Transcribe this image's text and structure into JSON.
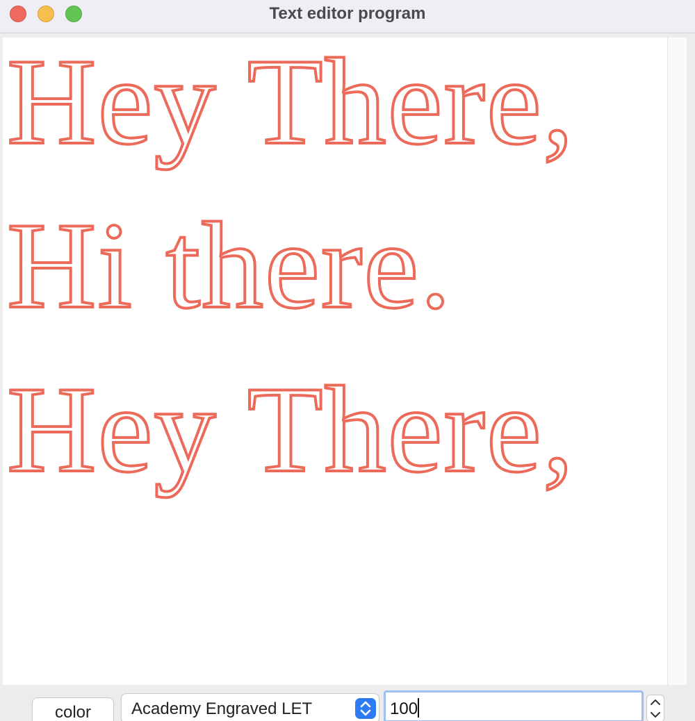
{
  "window": {
    "title": "Text editor program"
  },
  "editor": {
    "lines": [
      "Hey There,",
      "Hi there.",
      "Hey There,"
    ],
    "text_color": "#ec6a59"
  },
  "toolbar": {
    "color_label": "color",
    "font_selected": "Academy Engraved LET",
    "font_size_value": "100"
  },
  "icons": {
    "close": "close-window-icon",
    "minimize": "minimize-window-icon",
    "maximize": "maximize-window-icon",
    "select": "chevron-updown-icon",
    "stepper_up": "chevron-up-icon",
    "stepper_down": "chevron-down-icon"
  },
  "colors": {
    "accent": "#2f7bf5",
    "focus_ring": "#9fbff2",
    "close": "#ee6a5e",
    "minimize": "#f5bf4f",
    "maximize": "#61c554"
  }
}
